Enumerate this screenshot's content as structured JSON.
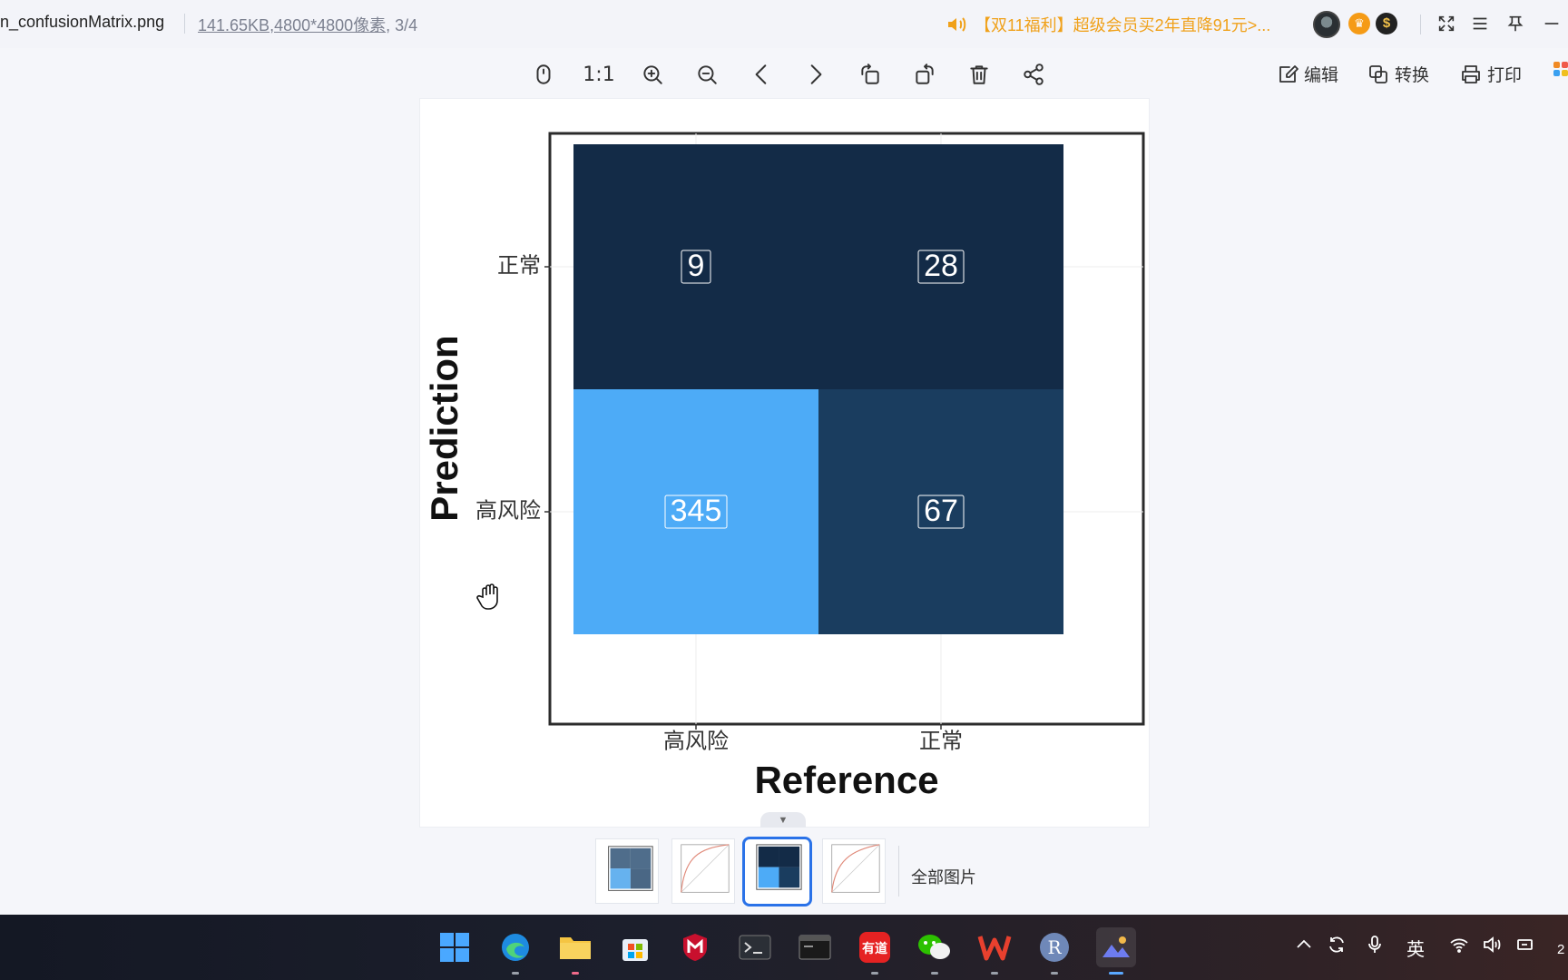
{
  "titlebar": {
    "filename": "n_confusionMatrix.png",
    "size": "141.65KB",
    "dims": ",4800*4800像素",
    "index": ", 3/4",
    "promo": "【双11福利】超级会员买2年直降91元>..."
  },
  "toolbar": {
    "ratio_label": "1:1",
    "edit_label": "编辑",
    "convert_label": "转换",
    "print_label": "打印"
  },
  "plot": {
    "ylabel": "Prediction",
    "xlabel": "Reference",
    "x_ticks": [
      "高风险",
      "正常"
    ],
    "y_ticks": [
      "正常",
      "高风险"
    ]
  },
  "chart_data": {
    "type": "heatmap",
    "x_categories": [
      "高风险",
      "正常"
    ],
    "y_categories": [
      "正常",
      "高风险"
    ],
    "xlabel": "Reference",
    "ylabel": "Prediction",
    "cells": [
      {
        "reference": "高风险",
        "prediction": "正常",
        "value": 9,
        "color": "#132b47"
      },
      {
        "reference": "正常",
        "prediction": "正常",
        "value": 28,
        "color": "#132b47"
      },
      {
        "reference": "高风险",
        "prediction": "高风险",
        "value": 345,
        "color": "#4dabf7"
      },
      {
        "reference": "正常",
        "prediction": "高风险",
        "value": 67,
        "color": "#1a3d5f"
      }
    ],
    "grid": true
  },
  "strip": {
    "all_label": "全部图片"
  },
  "taskbar": {
    "ime_label": "英",
    "clock_fragment": "2"
  },
  "colors": {
    "accent": "#2a72e8",
    "promo": "#f0a11a",
    "dark_cell": "#132b47",
    "mid_cell": "#1a3d5f",
    "light_cell": "#4dabf7"
  }
}
